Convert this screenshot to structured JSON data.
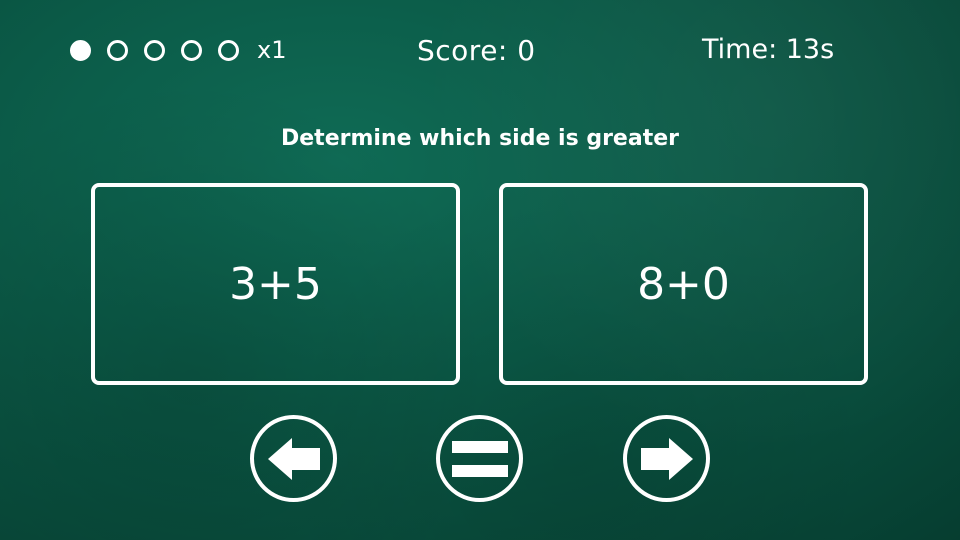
{
  "hud": {
    "lives_total": 5,
    "lives_filled": 1,
    "multiplier": "x1",
    "score": "Score: 0",
    "time": "Time: 13s"
  },
  "question": {
    "instruction": "Determine which side is greater",
    "left_expression": "3+5",
    "right_expression": "8+0"
  },
  "controls": {
    "left_icon": "arrow-left-icon",
    "equal_icon": "equals-icon",
    "right_icon": "arrow-right-icon"
  },
  "colors": {
    "background": "#0b5a47",
    "foreground": "#ffffff"
  }
}
